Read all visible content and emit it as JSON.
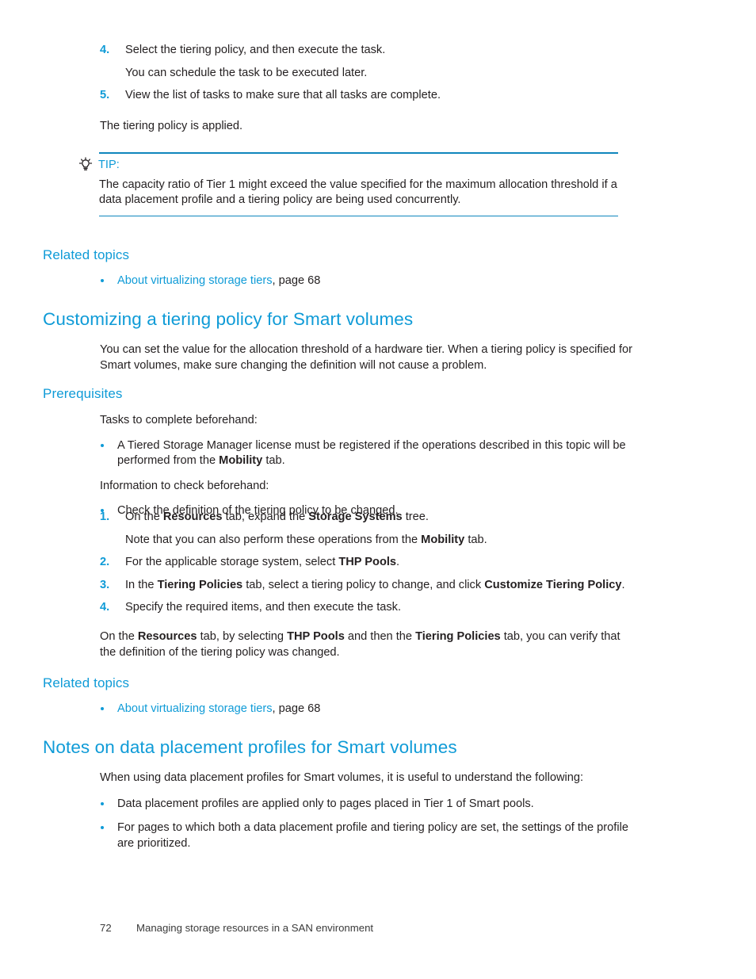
{
  "page": {
    "footer_page_number": "72",
    "footer_title": "Managing storage resources in a SAN environment",
    "accent_color": "#0f9bd7",
    "rule_color": "#0f86bd",
    "text_color": "#231f20"
  },
  "continued_steps": {
    "step4": {
      "number": "4.",
      "text": "Select the tiering policy, and then execute the task.",
      "note": "You can schedule the task to be executed later."
    },
    "step5": {
      "number": "5.",
      "text": "View the list of tasks to make sure that all tasks are complete."
    },
    "closing": "The tiering policy is applied."
  },
  "tip": {
    "icon": "lightbulb-icon",
    "label": "TIP:",
    "body_line1": "The capacity ratio of Tier 1 might exceed the value specified for the maximum allocation threshold if",
    "body_line2": "a data placement profile and a tiering policy are being used concurrently."
  },
  "related_topics_1": {
    "heading": "Related topics",
    "item_link": "About virtualizing storage tiers",
    "item_suffix": ", page 68"
  },
  "section_customizing": {
    "heading": "Customizing a tiering policy for Smart volumes",
    "intro_line1": "You can set the value for the allocation threshold of a hardware tier. When a tiering policy is specified",
    "intro_line2": "for Smart volumes, make sure changing the definition will not cause a problem.",
    "prerequisites": {
      "heading": "Prerequisites",
      "tasks_label": "Tasks to complete beforehand:",
      "task_bullet": {
        "part1": "A Tiered Storage Manager license must be registered if the operations described in this topic will be performed from the ",
        "bold1": "Mobility",
        "part2": " tab."
      },
      "info_label": "Information to check beforehand:",
      "info_bullet": "Check the definition of the tiering policy to be changed."
    },
    "steps": [
      {
        "number": "1.",
        "part1": "On the ",
        "bold1": "Resources",
        "part2": " tab, expand the ",
        "bold2": "Storage Systems",
        "part3": " tree.",
        "note_part1": "Note that you can also perform these operations from the ",
        "note_bold": "Mobility",
        "note_part2": " tab."
      },
      {
        "number": "2.",
        "part1": "For the applicable storage system, select ",
        "bold1": "THP Pools",
        "part2": "."
      },
      {
        "number": "3.",
        "part1": "In the ",
        "bold1": "Tiering Policies",
        "part2": " tab, select a tiering policy to change, and click ",
        "bold2": "Customize Tiering Policy",
        "part3": "."
      },
      {
        "number": "4.",
        "part1": "Specify the required items, and then execute the task.",
        "bold1": "",
        "part2": ""
      }
    ],
    "verify": {
      "part1": "On the ",
      "bold1": "Resources",
      "part2": " tab, by selecting ",
      "bold2": "THP Pools",
      "part3": " and then the ",
      "bold3": "Tiering Policies",
      "part4": " tab, you can verify that the definition of the tiering policy was changed."
    }
  },
  "related_topics_2": {
    "heading": "Related topics",
    "item_link": "About virtualizing storage tiers",
    "item_suffix": ", page 68"
  },
  "section_notes": {
    "heading": "Notes on data placement profiles for Smart volumes",
    "intro": "When using data placement profiles for Smart volumes, it is useful to understand the following:",
    "bullets": [
      "Data placement profiles are applied only to pages placed in Tier 1 of Smart pools.",
      "For pages to which both a data placement profile and tiering policy are set, the settings of the profile are prioritized."
    ]
  }
}
